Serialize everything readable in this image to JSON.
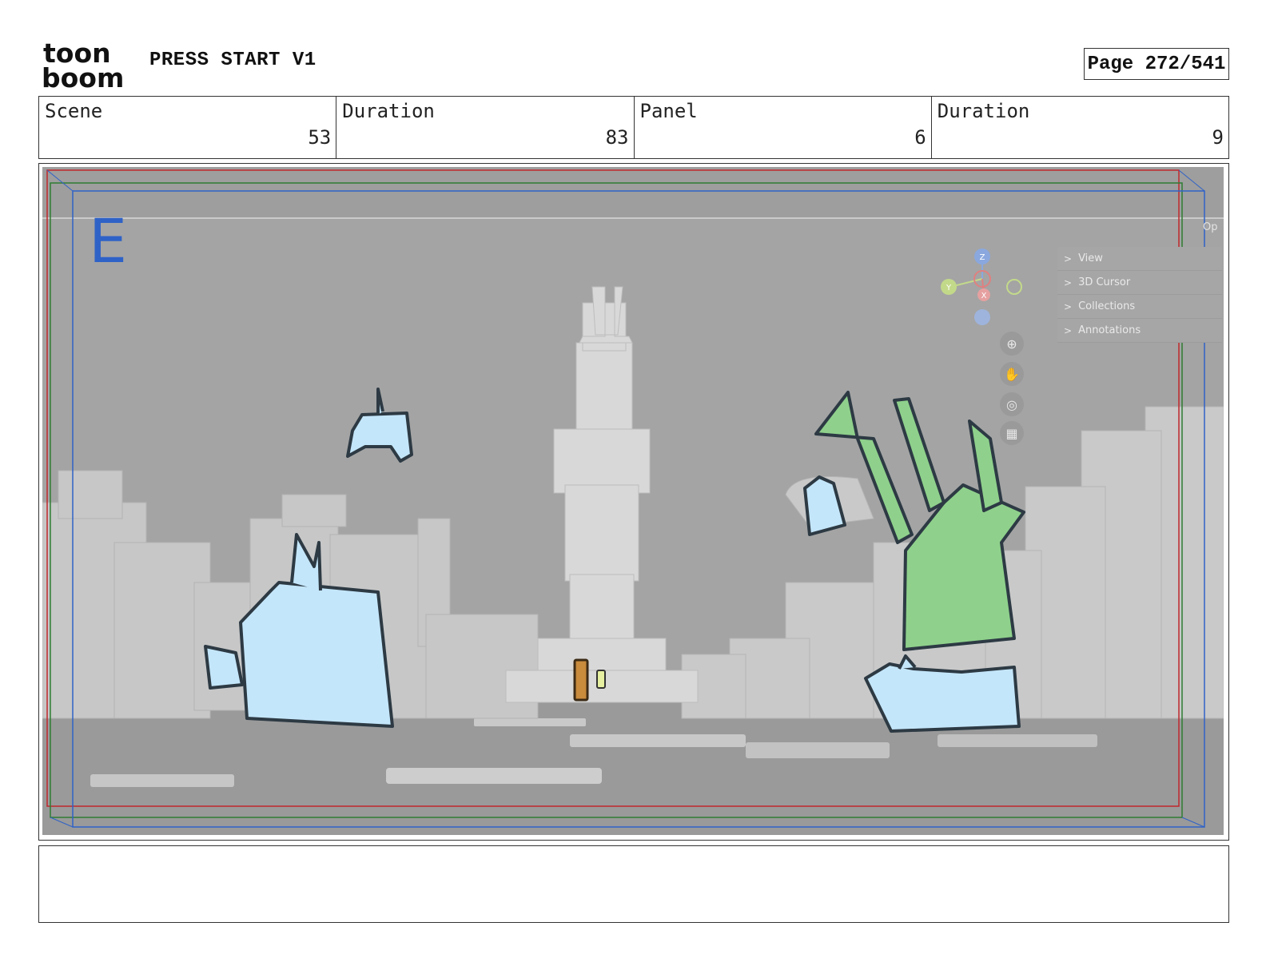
{
  "header": {
    "logo_text_top": "toon",
    "logo_text_bottom": "boom",
    "project_title": "PRESS START V1",
    "page_indicator": "Page 272/541"
  },
  "info": {
    "scene_label": "Scene",
    "scene_value": "53",
    "scene_duration_label": "Duration",
    "scene_duration_value": "83",
    "panel_label": "Panel",
    "panel_value": "6",
    "panel_duration_label": "Duration",
    "panel_duration_value": "9"
  },
  "panel": {
    "safe_area_letter": "E",
    "viewport_tab": "Op",
    "outliner_items": [
      "View",
      "3D Cursor",
      "Collections",
      "Annotations"
    ],
    "gizmo_axes": [
      "Z",
      "Y",
      "X"
    ],
    "tools": [
      "zoom-icon",
      "hand-icon",
      "camera-icon",
      "grid-icon"
    ],
    "colors": {
      "frame_red": "#c0282c",
      "frame_green": "#2f7d32",
      "frame_blue": "#2f62c7",
      "character_blue": "#c4e6fa",
      "character_green": "#8fd18c"
    }
  },
  "notes": {
    "text": ""
  }
}
